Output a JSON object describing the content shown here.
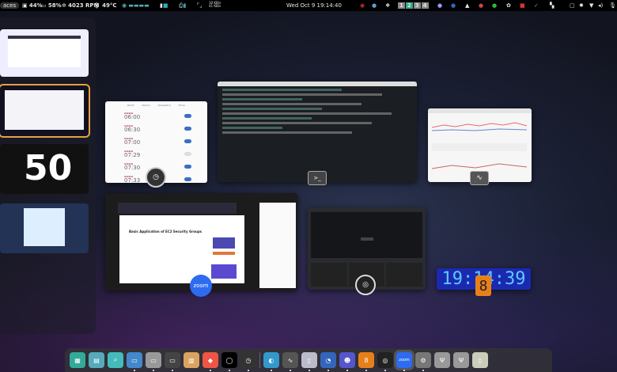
{
  "topbar": {
    "activities": "aces",
    "cpu": "44%",
    "mem": "58%",
    "fan": "4023 RPM",
    "temp": "49°C",
    "net_up": "10 KB/s",
    "net_down": "41 KB/s",
    "datetime": "Wed Oct 9  19:14:40",
    "workspaces": [
      "1",
      "2",
      "3",
      "4"
    ],
    "active_workspace": "2"
  },
  "clock_app": {
    "tabs": [
      "World",
      "Alarms",
      "Stopwatch",
      "Timer"
    ],
    "alarms": [
      {
        "time": "06:00",
        "enabled": true
      },
      {
        "time": "06:30",
        "enabled": true
      },
      {
        "time": "07:00",
        "enabled": true
      },
      {
        "time": "07:29",
        "enabled": false
      },
      {
        "time": "07:30",
        "enabled": true
      },
      {
        "time": "07:33",
        "enabled": true
      }
    ]
  },
  "zoom_window": {
    "page_title": "Basic Application of EC2 Security Groups",
    "icon_label": "zoom"
  },
  "digital_clock": {
    "time": "19:14:39"
  },
  "dock": {
    "items": [
      "app-grid",
      "files-manager",
      "search",
      "files",
      "folder",
      "terminal",
      "archive",
      "brave",
      "obsidian",
      "clocks",
      "kde-connect",
      "system-monitor",
      "disks",
      "thunderbird",
      "ghost",
      "digital-clock",
      "obs",
      "zoom",
      "settings",
      "usb-1",
      "usb-2",
      "document"
    ],
    "zoom_label": "zoom"
  },
  "colors": {
    "accent": "#e8a040",
    "toggle": "#3a6fc4",
    "digital": "#5fc8ff"
  }
}
